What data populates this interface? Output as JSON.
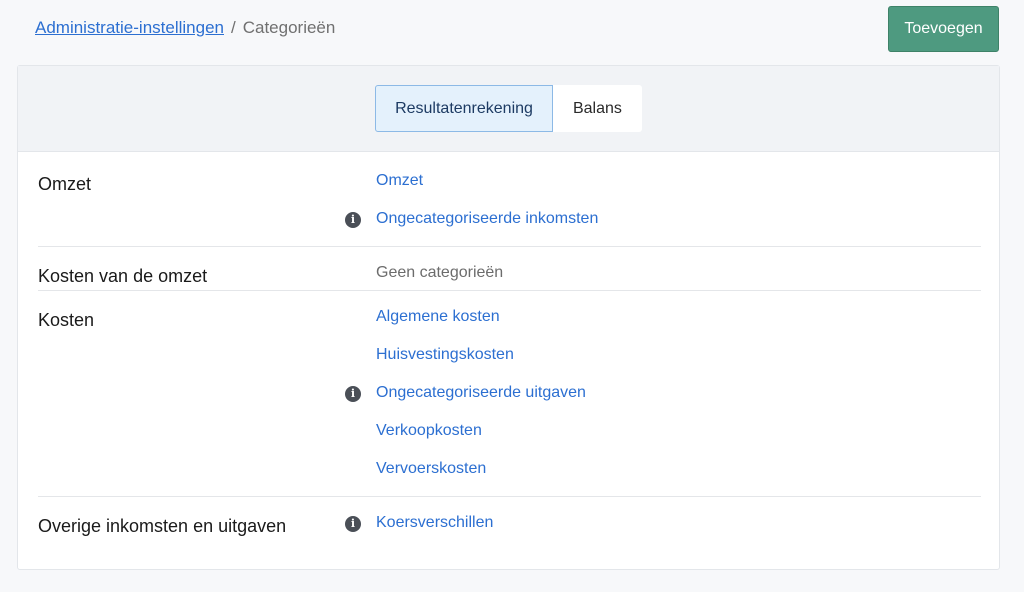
{
  "breadcrumb": {
    "parent": "Administratie-instellingen",
    "separator": "/",
    "current": "Categorieën"
  },
  "actions": {
    "add_label": "Toevoegen"
  },
  "tabs": [
    {
      "label": "Resultatenrekening",
      "active": true
    },
    {
      "label": "Balans",
      "active": false
    }
  ],
  "sections": [
    {
      "title": "Omzet",
      "items": [
        {
          "label": "Omzet",
          "info": false
        },
        {
          "label": "Ongecategoriseerde inkomsten",
          "info": true
        }
      ]
    },
    {
      "title": "Kosten van de omzet",
      "empty_text": "Geen categorieën"
    },
    {
      "title": "Kosten",
      "items": [
        {
          "label": "Algemene kosten",
          "info": false
        },
        {
          "label": "Huisvestingskosten",
          "info": false
        },
        {
          "label": "Ongecategoriseerde uitgaven",
          "info": true
        },
        {
          "label": "Verkoopkosten",
          "info": false
        },
        {
          "label": "Vervoerskosten",
          "info": false
        }
      ]
    },
    {
      "title": "Overige inkomsten en uitgaven",
      "items": [
        {
          "label": "Koersverschillen",
          "info": true
        }
      ]
    }
  ],
  "icons": {
    "info": "info-circle-icon",
    "info_glyph": "i"
  },
  "colors": {
    "link": "#2c6fd1",
    "primary_button": "#4e9a80",
    "active_tab_bg": "#e4f1fc"
  }
}
